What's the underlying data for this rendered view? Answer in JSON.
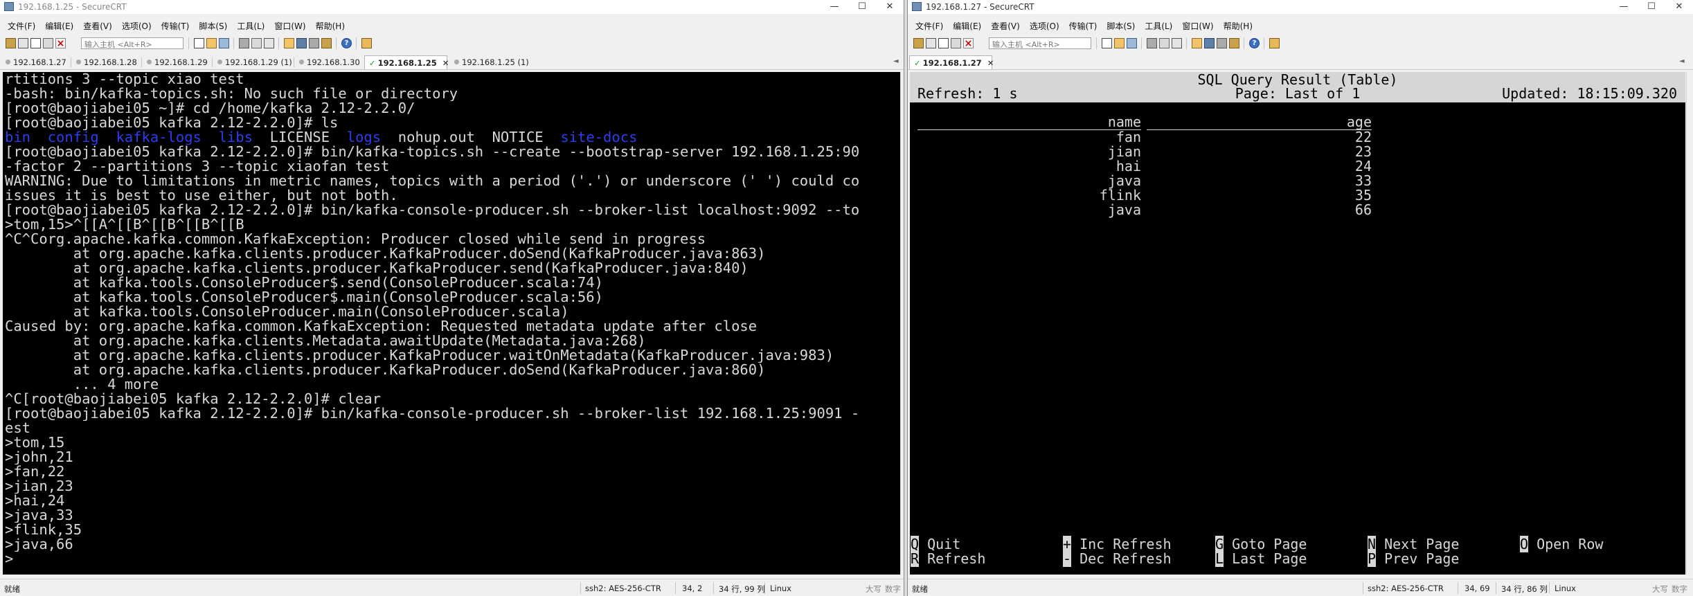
{
  "left_window": {
    "title": "192.168.1.25 - SecureCRT",
    "controls": {
      "minimize": "—",
      "maximize": "☐",
      "close": "✕"
    },
    "menu": [
      "文件(F)",
      "编辑(E)",
      "查看(V)",
      "选项(O)",
      "传输(T)",
      "脚本(S)",
      "工具(L)",
      "窗口(W)",
      "帮助(H)"
    ],
    "host_placeholder": "输入主机 <Alt+R>",
    "tabs": [
      "192.168.1.27",
      "192.168.1.28",
      "192.168.1.29",
      "192.168.1.29 (1)",
      "192.168.1.30",
      "192.168.1.25",
      "192.168.1.25 (1)"
    ],
    "active_tab": "192.168.1.25",
    "terminal_lines": [
      "rtitions 3 --topic xiao_test",
      "-bash: bin/kafka-topics.sh: No such file or directory",
      "[root@baojiabei05 ~]# cd /home/kafka_2.12-2.2.0/",
      "[root@baojiabei05 kafka_2.12-2.2.0]# ls",
      "",
      "[root@baojiabei05 kafka_2.12-2.2.0]# bin/kafka-topics.sh --create --bootstrap-server 192.168.1.25:90",
      "-factor 2 --partitions 3 --topic xiaofan_test",
      "WARNING: Due to limitations in metric names, topics with a period ('.') or underscore ('_') could co",
      "issues it is best to use either, but not both.",
      "[root@baojiabei05 kafka_2.12-2.2.0]# bin/kafka-console-producer.sh --broker-list localhost:9092 --to",
      ">tom,15>^[[A^[[B^[[B^[[B^[[B",
      "^C^Corg.apache.kafka.common.KafkaException: Producer closed while send in progress",
      "        at org.apache.kafka.clients.producer.KafkaProducer.doSend(KafkaProducer.java:863)",
      "        at org.apache.kafka.clients.producer.KafkaProducer.send(KafkaProducer.java:840)",
      "        at kafka.tools.ConsoleProducer$.send(ConsoleProducer.scala:74)",
      "        at kafka.tools.ConsoleProducer$.main(ConsoleProducer.scala:56)",
      "        at kafka.tools.ConsoleProducer.main(ConsoleProducer.scala)",
      "Caused by: org.apache.kafka.common.KafkaException: Requested metadata update after close",
      "        at org.apache.kafka.clients.Metadata.awaitUpdate(Metadata.java:268)",
      "        at org.apache.kafka.clients.producer.KafkaProducer.waitOnMetadata(KafkaProducer.java:983)",
      "        at org.apache.kafka.clients.producer.KafkaProducer.doSend(KafkaProducer.java:860)",
      "        ... 4 more",
      "^C[root@baojiabei05 kafka_2.12-2.2.0]# clear",
      "[root@baojiabei05 kafka_2.12-2.2.0]# bin/kafka-console-producer.sh --broker-list 192.168.1.25:9091 -",
      "est",
      ">tom,15",
      ">john,21",
      ">fan,22",
      ">jian,23",
      ">hai,24",
      ">java,33",
      ">flink,35",
      ">java,66",
      ">"
    ],
    "ls_output": {
      "blue_1": "bin",
      "blue_2": "config",
      "blue_3": "kafka-logs",
      "blue_4": "libs",
      "plain_1": "LICENSE",
      "blue_5": "logs",
      "plain_2": "nohup.out",
      "plain_3": "NOTICE",
      "blue_6": "site-docs"
    },
    "status": {
      "ready": "就绪",
      "ssh": "ssh2: AES-256-CTR",
      "cursor": "34,  2",
      "size": "34 行, 99 列",
      "os": "Linux",
      "caps": "大写",
      "num": "数字"
    }
  },
  "right_window": {
    "title": "192.168.1.27 - SecureCRT",
    "controls": {
      "minimize": "—",
      "maximize": "☐",
      "close": "✕"
    },
    "menu": [
      "文件(F)",
      "编辑(E)",
      "查看(V)",
      "选项(O)",
      "传输(T)",
      "脚本(S)",
      "工具(L)",
      "窗口(W)",
      "帮助(H)"
    ],
    "host_placeholder": "输入主机 <Alt+R>",
    "active_tab": "192.168.1.27",
    "sql": {
      "title": "SQL Query Result (Table)",
      "refresh": "Refresh: 1 s",
      "page": "Page: Last of 1",
      "updated": "Updated: 18:15:09.320",
      "columns": [
        "name",
        "age"
      ],
      "rows": [
        [
          "fan",
          "22"
        ],
        [
          "jian",
          "23"
        ],
        [
          "hai",
          "24"
        ],
        [
          "java",
          "33"
        ],
        [
          "flink",
          "35"
        ],
        [
          "java",
          "66"
        ]
      ]
    },
    "hotkeys": {
      "quit": {
        "key": "Q",
        "label": "Quit"
      },
      "refresh": {
        "key": "R",
        "label": "Refresh"
      },
      "inc_refresh": {
        "key": "+",
        "label": "Inc Refresh"
      },
      "dec_refresh": {
        "key": "-",
        "label": "Dec Refresh"
      },
      "goto_page": {
        "key": "G",
        "label": "Goto Page"
      },
      "last_page": {
        "key": "L",
        "label": "Last Page"
      },
      "next_page": {
        "key": "N",
        "label": "Next Page"
      },
      "prev_page": {
        "key": "P",
        "label": "Prev Page"
      },
      "open_row": {
        "key": "O",
        "label": "Open Row"
      }
    },
    "status": {
      "ready": "就绪",
      "ssh": "ssh2: AES-256-CTR",
      "cursor": "34, 69",
      "size": "34 行, 86 列",
      "os": "Linux",
      "caps": "大写",
      "num": "数字"
    }
  }
}
